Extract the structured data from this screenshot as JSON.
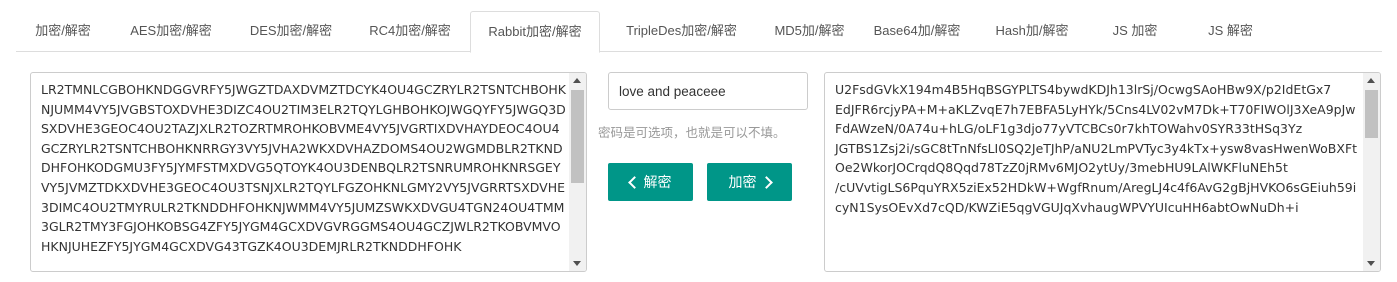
{
  "tabs": [
    {
      "label": "加密/解密",
      "active": false
    },
    {
      "label": "AES加密/解密",
      "active": false
    },
    {
      "label": "DES加密/解密",
      "active": false
    },
    {
      "label": "RC4加密/解密",
      "active": false
    },
    {
      "label": "Rabbit加密/解密",
      "active": true
    },
    {
      "label": "TripleDes加密/解密",
      "active": false
    },
    {
      "label": "MD5加/解密",
      "active": false
    },
    {
      "label": "Base64加/解密",
      "active": false
    },
    {
      "label": "Hash加/解密",
      "active": false
    },
    {
      "label": "JS 加密",
      "active": false
    },
    {
      "label": "JS 解密",
      "active": false
    }
  ],
  "left_text": "LR2TMNLCGBOHKNDGGVRFY5JWGZTDAXDVMZTDCYK4OU4GCZRYLR2TSNTCHBOHKNJUMM4VY5JVGBSTOXDVHE3DIZC4OU2TIM3ELR2TQYLGHBOHKOJWGQYFY5JWGQ3DSXDVHE3GEOC4OU2TAZJXLR2TOZRTMROHKOBVME4VY5JVGRTIXDVHAYDEOC4OU4GCZRYLR2TSNTCHBOHKNRRGY3VY5JVHA2WKXDVHAZDOMS4OU2WGMDBLR2TKNDDHFOHKODGMU3FY5JYMFSTMXDVG5QTOYK4OU3DENBQLR2TSNRUMROHKNRSGEYVY5JVMZTDKXDVHE3GEOC4OU3TSNJXLR2TQYLFGZOHKNLGMY2VY5JVGRRTSXDVHE3DIMC4OU2TMYRULR2TKNDDHFOHKNJWMM4VY5JUMZSWKXDVGU4TGN24OU4TMM3GLR2TMY3FGJOHKOBSG4ZFY5JYGM4GCXDVGVRGGMS4OU4GCZJWLR2TKOBVMVOHKNJUHEZFY5JYGM4GCXDVG43TGZK4OU3DEMJRLR2TKNDDHFOHK",
  "key_value": "love and peaceee",
  "hint": "密码是可选项，也就是可以不填。",
  "decrypt_label": "解密",
  "encrypt_label": "加密",
  "right_text": "U2FsdGVkX194m4B5HqBSGYPLTS4bywdKDJh13lrSj/OcwgSAoHBw9X/p2IdEtGx7\nEdJFR6rcjyPA+M+aKLZvqE7h7EBFA5LyHYk/5Cns4LV02vM7Dk+T70FIWOlJ3XeA9pJwFdAWzeN/0A74u+hLG/oLF1g3djo77yVTCBCs0r7khTOWahv0SYR33tHSq3Yz\nJGTBS1Zsj2i/sGC8tTnNfsLI0SQ2JeTJhP/aNU2LmPVTyc3y4kTx+ysw8vasHwenWoBXFtOe2WkorJOCrqdQ8Qqd78TzZ0jRMv6MJO2ytUy/3mebHU9LAlWKFluNEh5t\n/cUVvtigLS6PquYRX5ziEx52HDkW+WgfRnum/AregLJ4c4f6AvG2gBjHVKO6sGEiuh59icyN1SysOEvXd7cQD/KWZiE5qgVGUJqXvhaugWPVYUIcuHH6abtOwNuDh+i"
}
